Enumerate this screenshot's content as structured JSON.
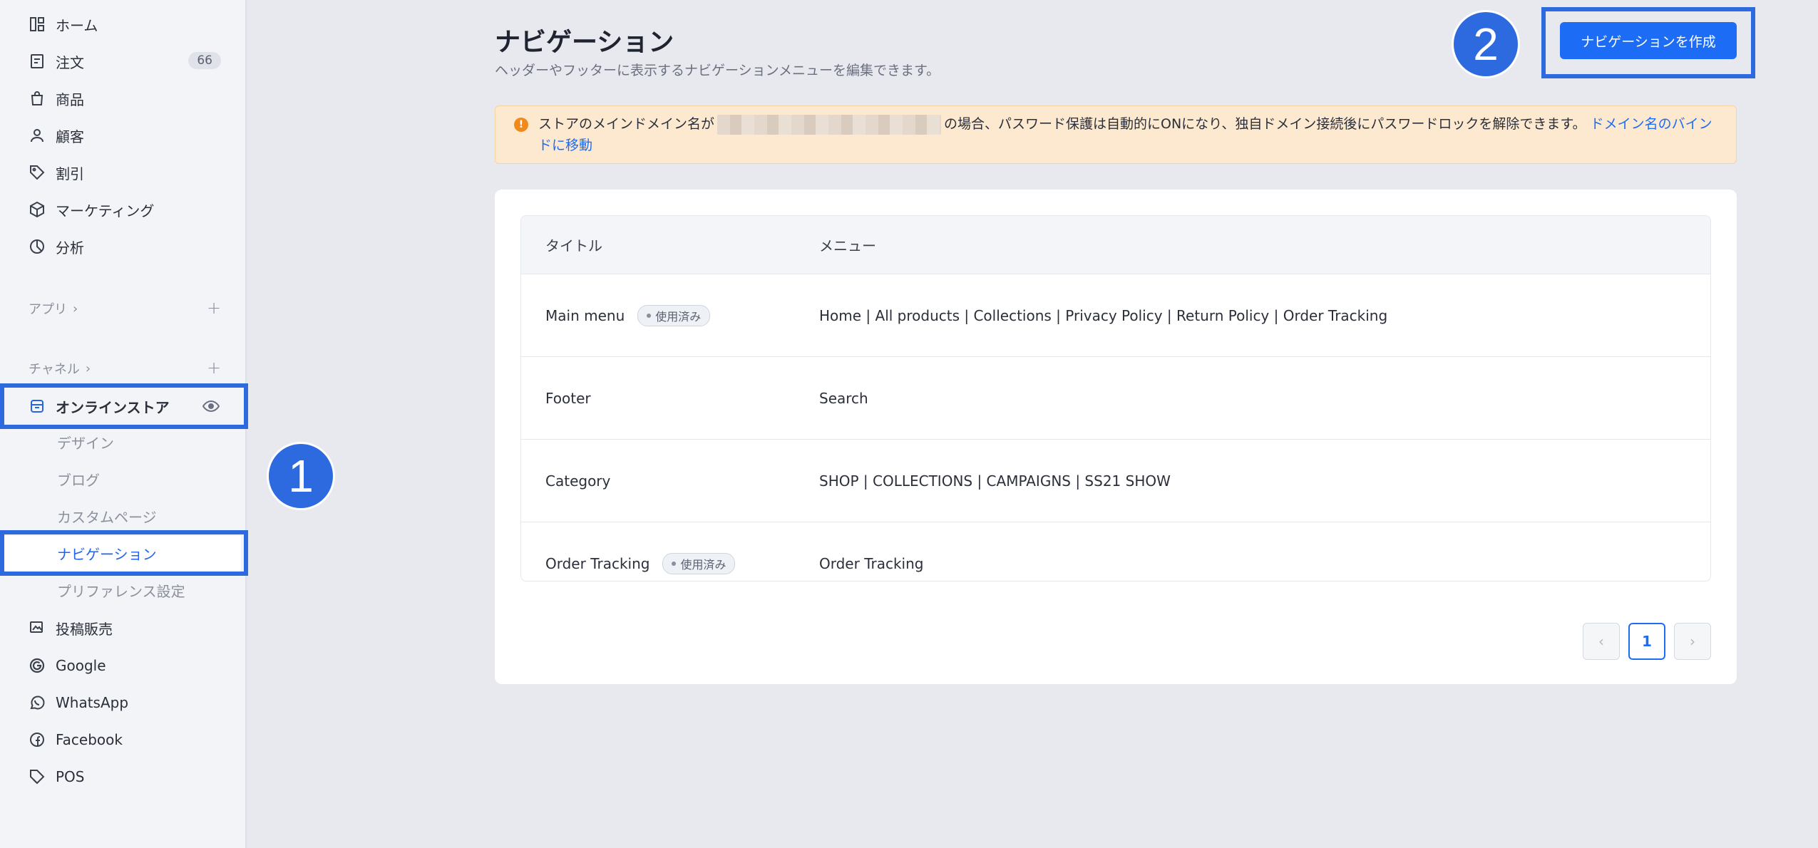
{
  "sidebar": {
    "items": [
      {
        "label": "ホーム",
        "icon": "home-grid-icon"
      },
      {
        "label": "注文",
        "icon": "order-icon",
        "count": "66"
      },
      {
        "label": "商品",
        "icon": "bag-icon"
      },
      {
        "label": "顧客",
        "icon": "user-icon"
      },
      {
        "label": "割引",
        "icon": "tag-icon"
      },
      {
        "label": "マーケティング",
        "icon": "cube-icon"
      },
      {
        "label": "分析",
        "icon": "pie-icon"
      }
    ],
    "apps_section": "アプリ",
    "channels_section": "チャネル",
    "online_store": "オンラインストア",
    "online_store_sub": [
      "デザイン",
      "ブログ",
      "カスタムページ",
      "ナビゲーション",
      "プリファレンス設定"
    ],
    "channels": [
      {
        "label": "投稿販売",
        "icon": "post-sale-icon"
      },
      {
        "label": "Google",
        "icon": "google-icon"
      },
      {
        "label": "WhatsApp",
        "icon": "whatsapp-icon"
      },
      {
        "label": "Facebook",
        "icon": "facebook-icon"
      },
      {
        "label": "POS",
        "icon": "pos-tag-icon"
      }
    ]
  },
  "steps": [
    "1",
    "2"
  ],
  "header": {
    "title": "ナビゲーション",
    "subtitle": "ヘッダーやフッターに表示するナビゲーションメニューを編集できます。",
    "create_button": "ナビゲーションを作成"
  },
  "alert": {
    "text_before": "ストアのメインドメイン名が",
    "text_after": "の場合、パスワード保護は自動的にONになり、独自ドメイン接続後にパスワードロックを解除できます。",
    "link": "ドメイン名のバインドに移動"
  },
  "table": {
    "headers": [
      "タイトル",
      "メニュー"
    ],
    "used_label": "使用済み",
    "rows": [
      {
        "title": "Main menu",
        "menu": "Home | All products | Collections | Privacy Policy | Return Policy | Order Tracking"
      },
      {
        "title": "Footer",
        "menu": "Search"
      },
      {
        "title": "Category",
        "menu": "SHOP | COLLECTIONS | CAMPAIGNS | SS21 SHOW"
      },
      {
        "title": "Order Tracking",
        "menu": "Order Tracking"
      }
    ]
  },
  "pagination": {
    "current": "1",
    "prev": "‹",
    "next": "›"
  },
  "colors": {
    "accent": "#1d6cf5",
    "highlight": "#2d6ae0",
    "alert_bg": "#fde9cf"
  }
}
